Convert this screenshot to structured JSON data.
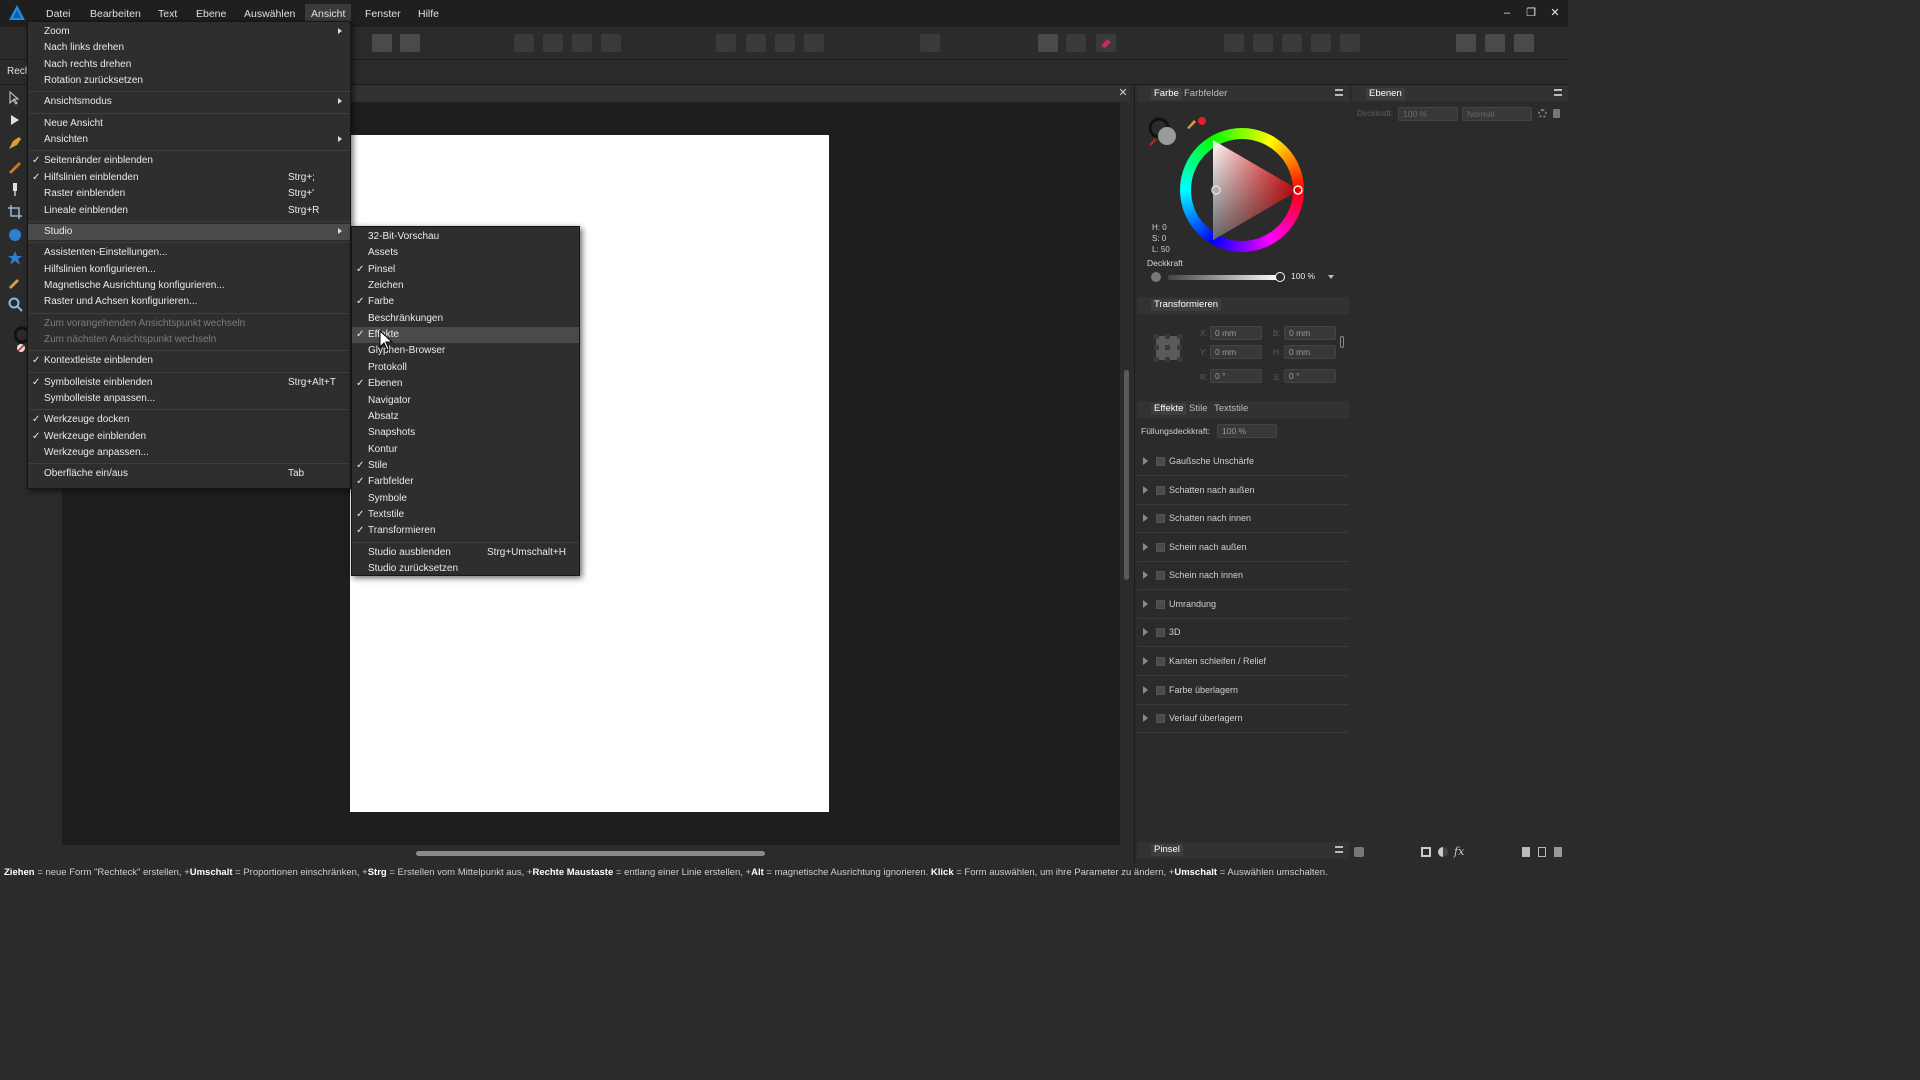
{
  "menubar": {
    "items": [
      "Datei",
      "Bearbeiten",
      "Text",
      "Ebene",
      "Auswählen",
      "Ansicht",
      "Fenster",
      "Hilfe"
    ],
    "window_buttons": [
      "minimize-icon",
      "restore-icon",
      "close-icon"
    ],
    "window_glyphs": [
      "–",
      "❐",
      "✕"
    ]
  },
  "document": {
    "tab_label": "Rech"
  },
  "tools": [
    "move-icon",
    "node-icon",
    "pen-icon",
    "pencil-icon",
    "brush-icon",
    "crop-icon",
    "ellipse-icon",
    "star-icon",
    "eyedropper-icon",
    "zoom-icon"
  ],
  "ansicht_menu": {
    "items": [
      {
        "label": "Zoom",
        "submenu": true
      },
      {
        "label": "Nach links drehen"
      },
      {
        "label": "Nach rechts drehen"
      },
      {
        "label": "Rotation zurücksetzen"
      },
      {
        "sep": true
      },
      {
        "label": "Ansichtsmodus",
        "submenu": true
      },
      {
        "sep": true
      },
      {
        "label": "Neue Ansicht"
      },
      {
        "label": "Ansichten",
        "submenu": true
      },
      {
        "sep": true
      },
      {
        "label": "Seitenränder einblenden",
        "checked": true
      },
      {
        "label": "Hilfslinien einblenden",
        "checked": true,
        "shortcut": "Strg+;"
      },
      {
        "label": "Raster einblenden",
        "shortcut": "Strg+'"
      },
      {
        "label": "Lineale einblenden",
        "shortcut": "Strg+R"
      },
      {
        "sep": true
      },
      {
        "label": "Studio",
        "submenu": true,
        "highlight": true
      },
      {
        "sep": true
      },
      {
        "label": "Assistenten-Einstellungen..."
      },
      {
        "label": "Hilfslinien konfigurieren..."
      },
      {
        "label": "Magnetische Ausrichtung konfigurieren..."
      },
      {
        "label": "Raster und Achsen konfigurieren..."
      },
      {
        "sep": true
      },
      {
        "label": "Zum vorangehenden Ansichtspunkt wechseln",
        "disabled": true
      },
      {
        "label": "Zum nächsten Ansichtspunkt wechseln",
        "disabled": true
      },
      {
        "sep": true
      },
      {
        "label": "Kontextleiste einblenden",
        "checked": true
      },
      {
        "sep": true
      },
      {
        "label": "Symbolleiste einblenden",
        "checked": true,
        "shortcut": "Strg+Alt+T"
      },
      {
        "label": "Symbolleiste anpassen..."
      },
      {
        "sep": true
      },
      {
        "label": "Werkzeuge docken",
        "checked": true
      },
      {
        "label": "Werkzeuge einblenden",
        "checked": true
      },
      {
        "label": "Werkzeuge anpassen..."
      },
      {
        "sep": true
      },
      {
        "label": "Oberfläche ein/aus",
        "shortcut": "Tab"
      }
    ]
  },
  "studio_menu": {
    "items": [
      {
        "label": "32-Bit-Vorschau"
      },
      {
        "label": "Assets"
      },
      {
        "label": "Pinsel",
        "checked": true
      },
      {
        "label": "Zeichen"
      },
      {
        "label": "Farbe",
        "checked": true
      },
      {
        "label": "Beschränkungen"
      },
      {
        "label": "Effekte",
        "checked": true,
        "highlight": true
      },
      {
        "label": "Glyphen-Browser"
      },
      {
        "label": "Protokoll"
      },
      {
        "label": "Ebenen",
        "checked": true
      },
      {
        "label": "Navigator"
      },
      {
        "label": "Absatz"
      },
      {
        "label": "Snapshots"
      },
      {
        "label": "Kontur"
      },
      {
        "label": "Stile",
        "checked": true
      },
      {
        "label": "Farbfelder",
        "checked": true
      },
      {
        "label": "Symbole"
      },
      {
        "label": "Textstile",
        "checked": true
      },
      {
        "label": "Transformieren",
        "checked": true
      },
      {
        "sep": true
      },
      {
        "label": "Studio ausblenden",
        "shortcut": "Strg+Umschalt+H"
      },
      {
        "label": "Studio zurücksetzen"
      }
    ]
  },
  "color_panel": {
    "tabs": [
      "Farbe",
      "Farbfelder"
    ],
    "h": "H: 0",
    "s": "S: 0",
    "l": "L: 50",
    "opacity_label": "Deckkraft",
    "opacity_value": "100 %",
    "opacity_level": 1.0,
    "accent": "#e0202a"
  },
  "layers_panel": {
    "tab": "Ebenen",
    "opacity_label": "Deckkraft:",
    "opacity_value": "100 %",
    "blend_mode": "Normal"
  },
  "transform_panel": {
    "tab": "Transformieren",
    "x_label": "X:",
    "x_value": "0 mm",
    "y_label": "Y:",
    "y_value": "0 mm",
    "b_label": "B:",
    "b_value": "0 mm",
    "h_label": "H:",
    "h_value": "0 mm",
    "r_label": "R:",
    "r_value": "0 °",
    "s_label": "S:",
    "s_value": "0 °"
  },
  "effects_panel": {
    "tabs": [
      "Effekte",
      "Stile",
      "Textstile"
    ],
    "fill_opacity_label": "Füllungsdeckkraft:",
    "fill_opacity_value": "100 %",
    "effects": [
      "Gaußsche Unschärfe",
      "Schatten nach außen",
      "Schatten nach innen",
      "Schein nach außen",
      "Schein nach innen",
      "Umrandung",
      "3D",
      "Kanten schleifen / Relief",
      "Farbe überlagern",
      "Verlauf überlagern"
    ]
  },
  "brush_panel": {
    "tab": "Pinsel"
  },
  "statusbar": {
    "parts": [
      {
        "b": "Ziehen",
        "t": " = neue Form \"Rechteck\" erstellen, +"
      },
      {
        "b": "Umschalt",
        "t": " = Proportionen einschränken, +"
      },
      {
        "b": "Strg",
        "t": " = Erstellen vom Mittelpunkt aus, +"
      },
      {
        "b": "Rechte Maustaste",
        "t": " = entlang einer Linie erstellen, +"
      },
      {
        "b": "Alt",
        "t": " = magnetische Ausrichtung ignorieren. "
      },
      {
        "b": "Klick",
        "t": " = Form auswählen, um ihre Parameter zu ändern, +"
      },
      {
        "b": "Umschalt",
        "t": " = Auswählen umschalten."
      }
    ]
  }
}
